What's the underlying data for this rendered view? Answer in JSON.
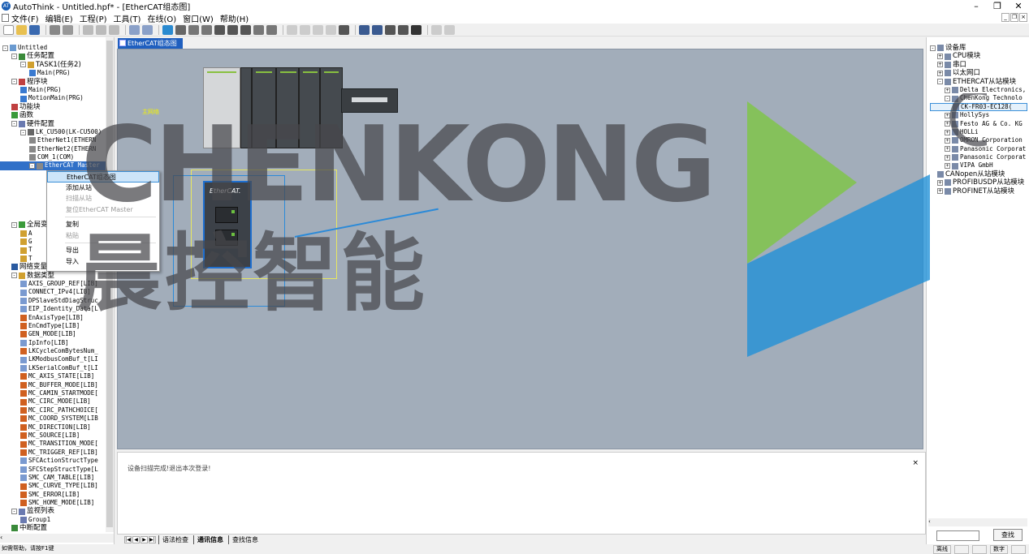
{
  "window": {
    "title": "AutoThink - Untitled.hpf* - [EtherCAT组态图]",
    "app_icon": "AT"
  },
  "menu": [
    "文件(F)",
    "编辑(E)",
    "工程(P)",
    "工具(T)",
    "在线(O)",
    "窗口(W)",
    "帮助(H)"
  ],
  "left_tree": [
    {
      "lv": 0,
      "exp": "-",
      "text": "Untitled",
      "icon": "project-icon",
      "color": "#6a9ad0"
    },
    {
      "lv": 1,
      "exp": "-",
      "text": "任务配置",
      "icon": "task-config-icon",
      "color": "#3a8a3a"
    },
    {
      "lv": 2,
      "exp": "-",
      "text": "TASK1(任务2)",
      "icon": "task-icon",
      "color": "#d0a030"
    },
    {
      "lv": 3,
      "exp": "",
      "text": "Main(PRG)",
      "icon": "program-icon",
      "color": "#3a7ad0"
    },
    {
      "lv": 1,
      "exp": "-",
      "text": "程序块",
      "icon": "program-block-icon",
      "color": "#c04040"
    },
    {
      "lv": 2,
      "exp": "",
      "text": "Main(PRG)",
      "icon": "program-icon",
      "color": "#3a7ad0"
    },
    {
      "lv": 2,
      "exp": "",
      "text": "MotionMain(PRG)",
      "icon": "program-icon",
      "color": "#3a7ad0"
    },
    {
      "lv": 1,
      "exp": "",
      "text": "功能块",
      "icon": "function-block-icon",
      "color": "#c04040"
    },
    {
      "lv": 1,
      "exp": "",
      "text": "函数",
      "icon": "function-icon",
      "color": "#3a9a3a"
    },
    {
      "lv": 1,
      "exp": "-",
      "text": "硬件配置",
      "icon": "hardware-icon",
      "color": "#6a7ab0"
    },
    {
      "lv": 2,
      "exp": "-",
      "text": "LK_CU500(LK-CU500)",
      "icon": "cpu-icon",
      "color": "#666666"
    },
    {
      "lv": 3,
      "exp": "",
      "text": "EtherNet1(ETHERN",
      "icon": "ethernet-icon",
      "color": "#888888"
    },
    {
      "lv": 3,
      "exp": "",
      "text": "EtherNet2(ETHERN",
      "icon": "ethernet-icon",
      "color": "#888888"
    },
    {
      "lv": 3,
      "exp": "",
      "text": "COM_1(COM)",
      "icon": "com-icon",
      "color": "#888888"
    },
    {
      "lv": 3,
      "exp": "-",
      "text": "EtherCAT Master",
      "icon": "ethercat-icon",
      "color": "#888888"
    },
    {
      "lv": 3,
      "exp": "",
      "text": "",
      "icon": "blank-icon",
      "color": "#ffffff"
    },
    {
      "lv": 3,
      "exp": "",
      "text": "",
      "icon": "blank-icon",
      "color": "#ffffff"
    },
    {
      "lv": 3,
      "exp": "",
      "text": "",
      "icon": "blank-icon",
      "color": "#ffffff"
    },
    {
      "lv": 3,
      "exp": "",
      "text": "",
      "icon": "blank-icon",
      "color": "#ffffff"
    },
    {
      "lv": 3,
      "exp": "",
      "text": "",
      "icon": "blank-icon",
      "color": "#ffffff"
    },
    {
      "lv": 3,
      "exp": "",
      "text": "",
      "icon": "blank-icon",
      "color": "#ffffff"
    },
    {
      "lv": 1,
      "exp": "-",
      "text": "全局变量",
      "icon": "global-var-icon",
      "color": "#3a9a3a"
    },
    {
      "lv": 2,
      "exp": "",
      "text": "A",
      "icon": "var-file-icon",
      "color": "#d0a030"
    },
    {
      "lv": 2,
      "exp": "",
      "text": "G",
      "icon": "var-file-icon",
      "color": "#d0a030"
    },
    {
      "lv": 2,
      "exp": "",
      "text": "T",
      "icon": "var-file-icon",
      "color": "#d0a030"
    },
    {
      "lv": 2,
      "exp": "",
      "text": "T",
      "icon": "var-file-icon",
      "color": "#d0a030"
    },
    {
      "lv": 1,
      "exp": "",
      "text": "网络变量",
      "icon": "network-icon",
      "color": "#2a5aa0"
    },
    {
      "lv": 1,
      "exp": "-",
      "text": "数据类型",
      "icon": "datatype-icon",
      "color": "#d0a030"
    },
    {
      "lv": 2,
      "exp": "",
      "text": "AXIS_GROUP_REF[LIB]",
      "icon": "struct-icon",
      "color": "#7a9ad0"
    },
    {
      "lv": 2,
      "exp": "",
      "text": "CONNECT_IPv4[LIB]",
      "icon": "struct-icon",
      "color": "#7a9ad0"
    },
    {
      "lv": 2,
      "exp": "",
      "text": "DPSlaveStdDiagStruc",
      "icon": "struct-icon",
      "color": "#7a9ad0"
    },
    {
      "lv": 2,
      "exp": "",
      "text": "EIP_Identity_Data[L",
      "icon": "struct-icon",
      "color": "#7a9ad0"
    },
    {
      "lv": 2,
      "exp": "",
      "text": "EnAxisType[LIB]",
      "icon": "enum-icon",
      "color": "#d06020"
    },
    {
      "lv": 2,
      "exp": "",
      "text": "EnCmdType[LIB]",
      "icon": "enum-icon",
      "color": "#d06020"
    },
    {
      "lv": 2,
      "exp": "",
      "text": "GEN_MODE[LIB]",
      "icon": "enum-icon",
      "color": "#d06020"
    },
    {
      "lv": 2,
      "exp": "",
      "text": "IpInfo[LIB]",
      "icon": "struct-icon",
      "color": "#7a9ad0"
    },
    {
      "lv": 2,
      "exp": "",
      "text": "LKCycleComBytesNum_",
      "icon": "enum-icon",
      "color": "#d06020"
    },
    {
      "lv": 2,
      "exp": "",
      "text": "LKModbusComBuf_t[LI",
      "icon": "struct-icon",
      "color": "#7a9ad0"
    },
    {
      "lv": 2,
      "exp": "",
      "text": "LKSerialComBuf_t[LI",
      "icon": "struct-icon",
      "color": "#7a9ad0"
    },
    {
      "lv": 2,
      "exp": "",
      "text": "MC_AXIS_STATE[LIB]",
      "icon": "enum-icon",
      "color": "#d06020"
    },
    {
      "lv": 2,
      "exp": "",
      "text": "MC_BUFFER_MODE[LIB]",
      "icon": "enum-icon",
      "color": "#d06020"
    },
    {
      "lv": 2,
      "exp": "",
      "text": "MC_CAMIN_STARTMODE[",
      "icon": "enum-icon",
      "color": "#d06020"
    },
    {
      "lv": 2,
      "exp": "",
      "text": "MC_CIRC_MODE[LIB]",
      "icon": "enum-icon",
      "color": "#d06020"
    },
    {
      "lv": 2,
      "exp": "",
      "text": "MC_CIRC_PATHCHOICE[",
      "icon": "enum-icon",
      "color": "#d06020"
    },
    {
      "lv": 2,
      "exp": "",
      "text": "MC_COORD_SYSTEM[LIB",
      "icon": "enum-icon",
      "color": "#d06020"
    },
    {
      "lv": 2,
      "exp": "",
      "text": "MC_DIRECTION[LIB]",
      "icon": "enum-icon",
      "color": "#d06020"
    },
    {
      "lv": 2,
      "exp": "",
      "text": "MC_SOURCE[LIB]",
      "icon": "enum-icon",
      "color": "#d06020"
    },
    {
      "lv": 2,
      "exp": "",
      "text": "MC_TRANSITION_MODE[",
      "icon": "enum-icon",
      "color": "#d06020"
    },
    {
      "lv": 2,
      "exp": "",
      "text": "MC_TRIGGER_REF[LIB]",
      "icon": "enum-icon",
      "color": "#d06020"
    },
    {
      "lv": 2,
      "exp": "",
      "text": "SFCActionStructType",
      "icon": "struct-icon",
      "color": "#7a9ad0"
    },
    {
      "lv": 2,
      "exp": "",
      "text": "SFCStepStructType[L",
      "icon": "struct-icon",
      "color": "#7a9ad0"
    },
    {
      "lv": 2,
      "exp": "",
      "text": "SMC_CAM_TABLE[LIB]",
      "icon": "struct-icon",
      "color": "#7a9ad0"
    },
    {
      "lv": 2,
      "exp": "",
      "text": "SMC_CURVE_TYPE[LIB]",
      "icon": "enum-icon",
      "color": "#d06020"
    },
    {
      "lv": 2,
      "exp": "",
      "text": "SMC_ERROR[LIB]",
      "icon": "enum-icon",
      "color": "#d06020"
    },
    {
      "lv": 2,
      "exp": "",
      "text": "SMC_HOME_MODE[LIB]",
      "icon": "enum-icon",
      "color": "#d06020"
    },
    {
      "lv": 1,
      "exp": "-",
      "text": "监视列表",
      "icon": "watch-list-icon",
      "color": "#6a7ab0"
    },
    {
      "lv": 2,
      "exp": "",
      "text": "Group1",
      "icon": "group-icon",
      "color": "#6a7ab0"
    },
    {
      "lv": 1,
      "exp": "",
      "text": "中断配置",
      "icon": "interrupt-icon",
      "color": "#3a8a3a"
    }
  ],
  "doc_tab": "EtherCAT组态图",
  "canvas": {
    "main_label": "主网络",
    "ethercat_logo": "EtherCAT."
  },
  "context_menu": {
    "items": [
      {
        "label": "EtherCAT组态图",
        "state": "sel"
      },
      {
        "label": "添加从站",
        "state": ""
      },
      {
        "label": "扫描从站",
        "state": "dis"
      },
      {
        "label": "复位EtherCAT Master",
        "state": "dis"
      },
      {
        "label": "复制",
        "state": ""
      },
      {
        "label": "粘贴",
        "state": "dis"
      },
      {
        "label": "导出",
        "state": ""
      },
      {
        "label": "导入",
        "state": ""
      }
    ]
  },
  "output": {
    "message": "设备扫描完成!退出本次登录!",
    "close": "×"
  },
  "output_tabs": [
    "语法检查",
    "通讯信息",
    "查找信息"
  ],
  "right_tree": [
    {
      "lv": 0,
      "exp": "-",
      "text": "设备库",
      "icon": "device-lib-icon",
      "sel": false
    },
    {
      "lv": 1,
      "exp": "+",
      "text": "CPU模块",
      "icon": "cpu-module-icon",
      "sel": false
    },
    {
      "lv": 1,
      "exp": "+",
      "text": "串口",
      "icon": "serial-icon",
      "sel": false
    },
    {
      "lv": 1,
      "exp": "+",
      "text": "以太网口",
      "icon": "ethernet-port-icon",
      "sel": false
    },
    {
      "lv": 1,
      "exp": "-",
      "text": "ETHERCAT从站模块",
      "icon": "ethercat-slave-icon",
      "sel": false
    },
    {
      "lv": 2,
      "exp": "+",
      "text": "Delta Electronics,",
      "icon": "vendor-icon",
      "sel": false
    },
    {
      "lv": 2,
      "exp": "-",
      "text": "ChenKong Technolo",
      "icon": "vendor-icon",
      "sel": false
    },
    {
      "lv": 3,
      "exp": "",
      "text": "CK-FR03-EC128(",
      "icon": "module-icon",
      "sel": true
    },
    {
      "lv": 2,
      "exp": "+",
      "text": "HollySys",
      "icon": "vendor-icon",
      "sel": false
    },
    {
      "lv": 2,
      "exp": "+",
      "text": "Festo AG & Co. KG",
      "icon": "vendor-icon",
      "sel": false
    },
    {
      "lv": 2,
      "exp": "+",
      "text": "HOLLi",
      "icon": "vendor-icon",
      "sel": false
    },
    {
      "lv": 2,
      "exp": "+",
      "text": "OMRON Corporation",
      "icon": "vendor-icon",
      "sel": false
    },
    {
      "lv": 2,
      "exp": "+",
      "text": "Panasonic Corporat",
      "icon": "vendor-icon",
      "sel": false
    },
    {
      "lv": 2,
      "exp": "+",
      "text": "Panasonic Corporat",
      "icon": "vendor-icon",
      "sel": false
    },
    {
      "lv": 2,
      "exp": "+",
      "text": "VIPA GmbH",
      "icon": "vendor-icon",
      "sel": false
    },
    {
      "lv": 1,
      "exp": "",
      "text": "CANopen从站模块",
      "icon": "canopen-icon",
      "sel": false
    },
    {
      "lv": 1,
      "exp": "+",
      "text": "PROFIBUSDP从站模块",
      "icon": "profibus-icon",
      "sel": false
    },
    {
      "lv": 1,
      "exp": "+",
      "text": "PROFINET从站模块",
      "icon": "profinet-icon",
      "sel": false
    }
  ],
  "search": {
    "button": "查找",
    "value": ""
  },
  "status": {
    "left": "如需帮助，请按F1键",
    "right": [
      "离线",
      "",
      "",
      "数字",
      ""
    ]
  },
  "watermark": {
    "en": "CHENKONG",
    "cn": "晨控智能"
  }
}
